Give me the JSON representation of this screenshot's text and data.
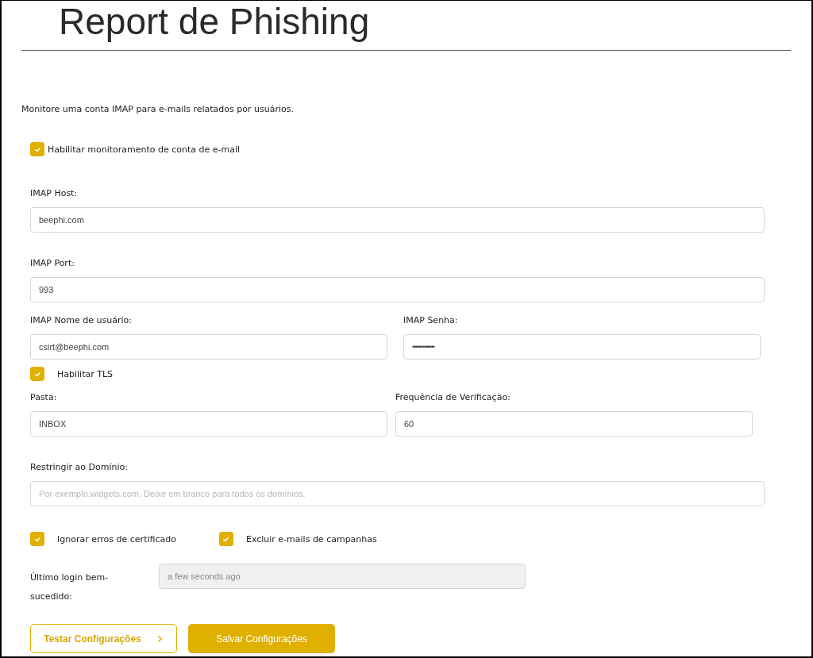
{
  "page": {
    "title": "Report de Phishing",
    "description": "Monitore uma conta IMAP para e-mails relatados por usuários."
  },
  "enable": {
    "label": "Habilitar monitoramento de conta de e-mail",
    "checked": true
  },
  "host": {
    "label": "IMAP Host:",
    "value": "beephi.com"
  },
  "port": {
    "label": "IMAP Port:",
    "value": "993"
  },
  "username": {
    "label": "IMAP Nome de usuário:",
    "value": "csirt@beephi.com"
  },
  "password": {
    "label": "IMAP Senha:",
    "value": "•••••••••••••"
  },
  "tls": {
    "label": "Habilitar TLS",
    "checked": true
  },
  "folder": {
    "label": "Pasta:",
    "value": "INBOX"
  },
  "frequency": {
    "label": "Frequência de Verificação:",
    "value": "60"
  },
  "domain": {
    "label": "Restringir ao Domínio:",
    "placeholder": "Por exemplo.widgets.com. Deixe em branco para todos os domínios."
  },
  "options": [
    {
      "label": "Ignorar erros de certificado",
      "checked": true
    },
    {
      "label": "Excluir e-mails de campanhas",
      "checked": true
    }
  ],
  "last_login": {
    "label": "Último login bem-sucedido:",
    "value": "a few seconds ago"
  },
  "buttons": {
    "test": "Testar Configurações",
    "save": "Salvar Configurações"
  }
}
